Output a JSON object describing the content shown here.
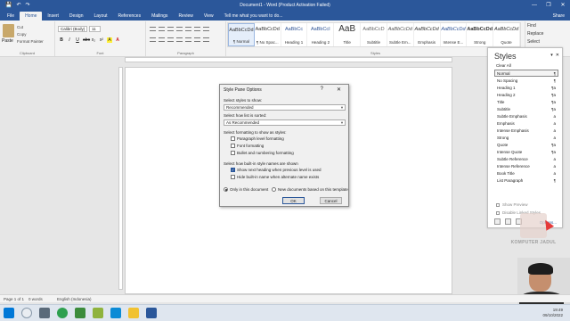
{
  "titlebar": {
    "title": "Document1 - Word (Product Activation Failed)",
    "qat": [
      "💾",
      "↶",
      "↷"
    ],
    "window_buttons": [
      "—",
      "❐",
      "✕"
    ]
  },
  "tabs": {
    "items": [
      "File",
      "Home",
      "Insert",
      "Design",
      "Layout",
      "References",
      "Mailings",
      "Review",
      "View"
    ],
    "tell_me": "Tell me what you want to do...",
    "share": "Share"
  },
  "ribbon": {
    "clipboard": {
      "paste": "Paste",
      "cut": "Cut",
      "copy": "Copy",
      "format_painter": "Format Painter",
      "label": "Clipboard"
    },
    "font": {
      "name": "Calibri (Body)",
      "size": "11",
      "label": "Font",
      "buttons": [
        "B",
        "I",
        "U",
        "abc",
        "x₂",
        "x²",
        "A",
        "A"
      ]
    },
    "paragraph": {
      "label": "Paragraph"
    },
    "styles": {
      "label": "Styles",
      "items": [
        {
          "preview": "AaBbCcDd",
          "name": "¶ Normal"
        },
        {
          "preview": "AaBbCcDd",
          "name": "¶ No Spac..."
        },
        {
          "preview": "AaBbCc",
          "name": "Heading 1"
        },
        {
          "preview": "AaBbCcI",
          "name": "Heading 2"
        },
        {
          "preview": "AaB",
          "name": "Title"
        },
        {
          "preview": "AaBbCcD",
          "name": "Subtitle"
        },
        {
          "preview": "AaBbCcDd",
          "name": "Subtle Em..."
        },
        {
          "preview": "AaBbCcDd",
          "name": "Emphasis"
        },
        {
          "preview": "AaBbCcDd",
          "name": "Intense E..."
        },
        {
          "preview": "AaBbCcDd",
          "name": "Strong"
        },
        {
          "preview": "AaBbCcDd",
          "name": "Quote"
        }
      ]
    },
    "editing": {
      "find": "Find",
      "replace": "Replace",
      "select": "Select"
    }
  },
  "styles_pane": {
    "title": "Styles",
    "clear_all": "Clear All",
    "items": [
      {
        "name": "Normal",
        "mark": "¶"
      },
      {
        "name": "No Spacing",
        "mark": "¶"
      },
      {
        "name": "Heading 1",
        "mark": "¶a"
      },
      {
        "name": "Heading 2",
        "mark": "¶a"
      },
      {
        "name": "Title",
        "mark": "¶a"
      },
      {
        "name": "Subtitle",
        "mark": "¶a"
      },
      {
        "name": "Subtle Emphasis",
        "mark": "a"
      },
      {
        "name": "Emphasis",
        "mark": "a"
      },
      {
        "name": "Intense Emphasis",
        "mark": "a"
      },
      {
        "name": "Strong",
        "mark": "a"
      },
      {
        "name": "Quote",
        "mark": "¶a"
      },
      {
        "name": "Intense Quote",
        "mark": "¶a"
      },
      {
        "name": "Subtle Reference",
        "mark": "a"
      },
      {
        "name": "Intense Reference",
        "mark": "a"
      },
      {
        "name": "Book Title",
        "mark": "a"
      },
      {
        "name": "List Paragraph",
        "mark": "¶"
      }
    ],
    "show_preview": "Show Preview",
    "disable_linked": "Disable Linked Styles",
    "options_link": "Options..."
  },
  "dialog": {
    "title": "Style Pane Options",
    "help": "?",
    "close": "✕",
    "select_styles_label": "Select styles to show:",
    "select_styles_value": "Recommended",
    "sort_label": "Select how list is sorted:",
    "sort_value": "As Recommended",
    "formatting_label": "Select formatting to show as styles:",
    "formatting_options": [
      {
        "label": "Paragraph level formatting",
        "checked": false
      },
      {
        "label": "Font formatting",
        "checked": false
      },
      {
        "label": "Bullet and numbering formatting",
        "checked": false
      }
    ],
    "builtin_label": "Select how built-in style names are shown",
    "builtin_options": [
      {
        "label": "Show next heading when previous level is used",
        "checked": true
      },
      {
        "label": "Hide built-in name when alternate name exists",
        "checked": false
      }
    ],
    "radio_this_doc": "Only in this document",
    "radio_new_docs": "New documents based on this template",
    "ok": "OK",
    "cancel": "Cancel"
  },
  "status_bar": {
    "page": "Page 1 of 1",
    "words": "0 words",
    "language": "English (Indonesia)"
  },
  "watermark": {
    "text": "KOMPUTER JADUL"
  },
  "taskbar": {
    "time": "19:49",
    "date": "09/10/2022"
  }
}
